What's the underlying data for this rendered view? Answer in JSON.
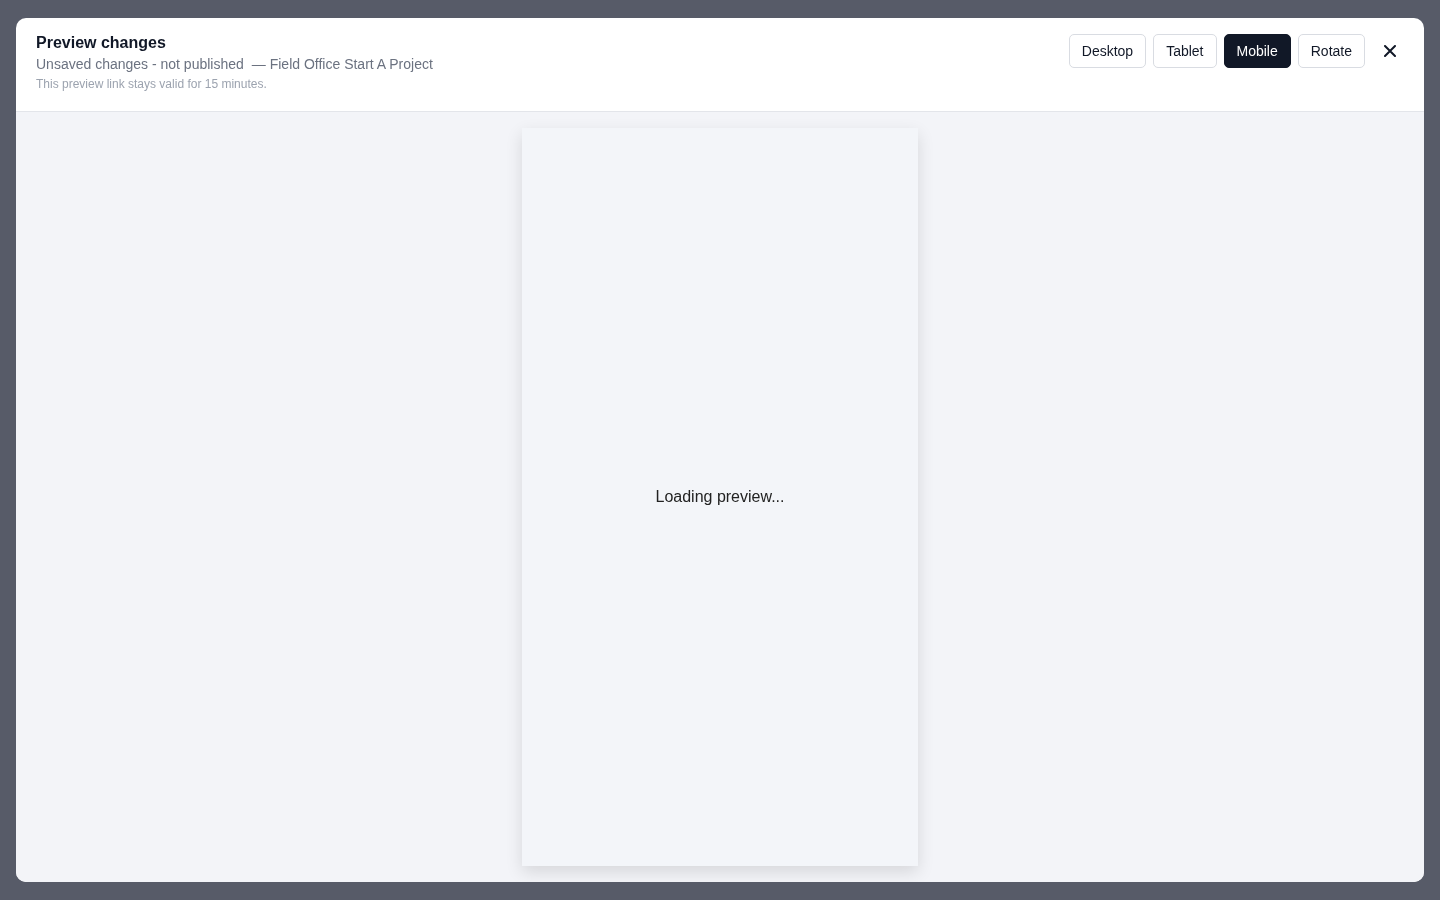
{
  "dialog": {
    "title": "Preview changes",
    "status": "Unsaved changes - not published",
    "project": "— Field Office Start A Project",
    "note": "This preview link stays valid for 15 minutes.",
    "view_buttons": [
      {
        "label": "Desktop",
        "selected": false
      },
      {
        "label": "Tablet",
        "selected": false
      },
      {
        "label": "Mobile",
        "selected": true
      },
      {
        "label": "Rotate",
        "selected": false
      }
    ],
    "preview": {
      "message": "Loading preview..."
    }
  }
}
